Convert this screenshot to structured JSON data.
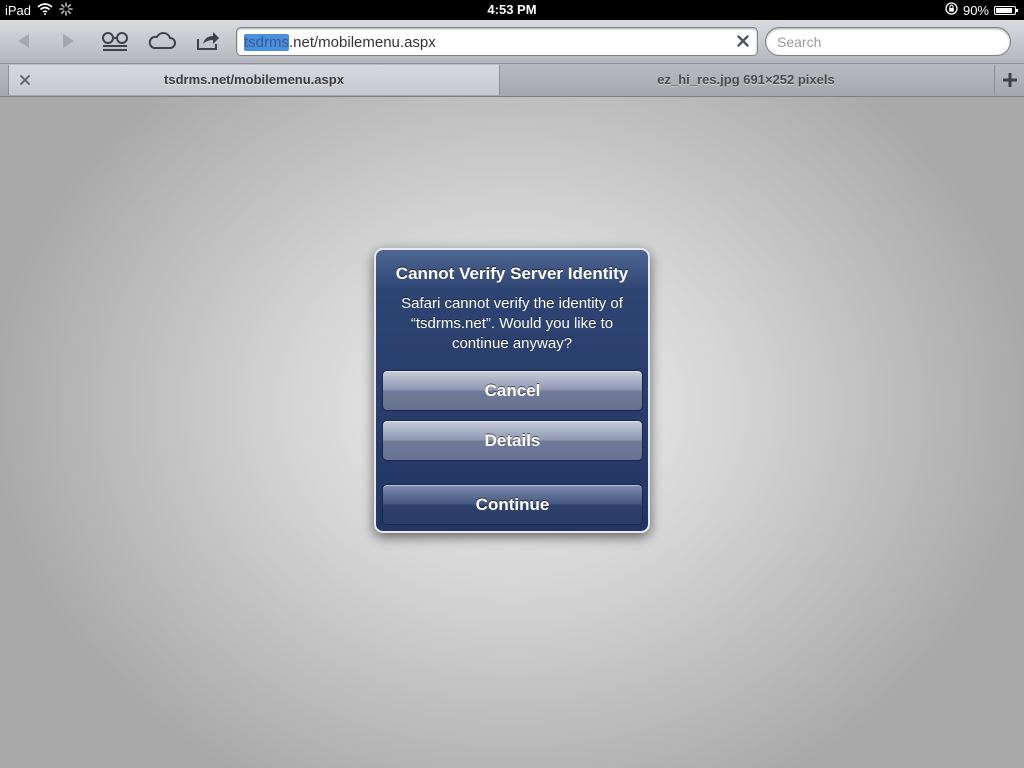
{
  "status_bar": {
    "device": "iPad",
    "time": "4:53 PM",
    "battery": "90%",
    "battery_level": 0.9
  },
  "toolbar": {
    "url": {
      "selected": "tsdrms",
      "rest": ".net/mobilemenu.aspx"
    },
    "search_placeholder": "Search"
  },
  "tabs": [
    {
      "label": "tsdrms.net/mobilemenu.aspx"
    },
    {
      "label": "ez_hi_res.jpg 691×252 pixels"
    }
  ],
  "alert": {
    "title": "Cannot Verify Server Identity",
    "message": "Safari cannot verify the identity of “tsdrms.net”. Would you like to continue anyway?",
    "buttons": {
      "cancel": "Cancel",
      "details": "Details",
      "continue": "Continue"
    }
  },
  "icons": {
    "back": "back-arrow-icon",
    "forward": "forward-arrow-icon",
    "reading_list": "reading-list-icon",
    "icloud": "cloud-icon",
    "share": "share-icon",
    "clear": "close-icon",
    "new_tab": "plus-icon",
    "wifi": "wifi-icon",
    "activity": "activity-spinner-icon",
    "rotation_lock": "rotation-lock-icon"
  }
}
